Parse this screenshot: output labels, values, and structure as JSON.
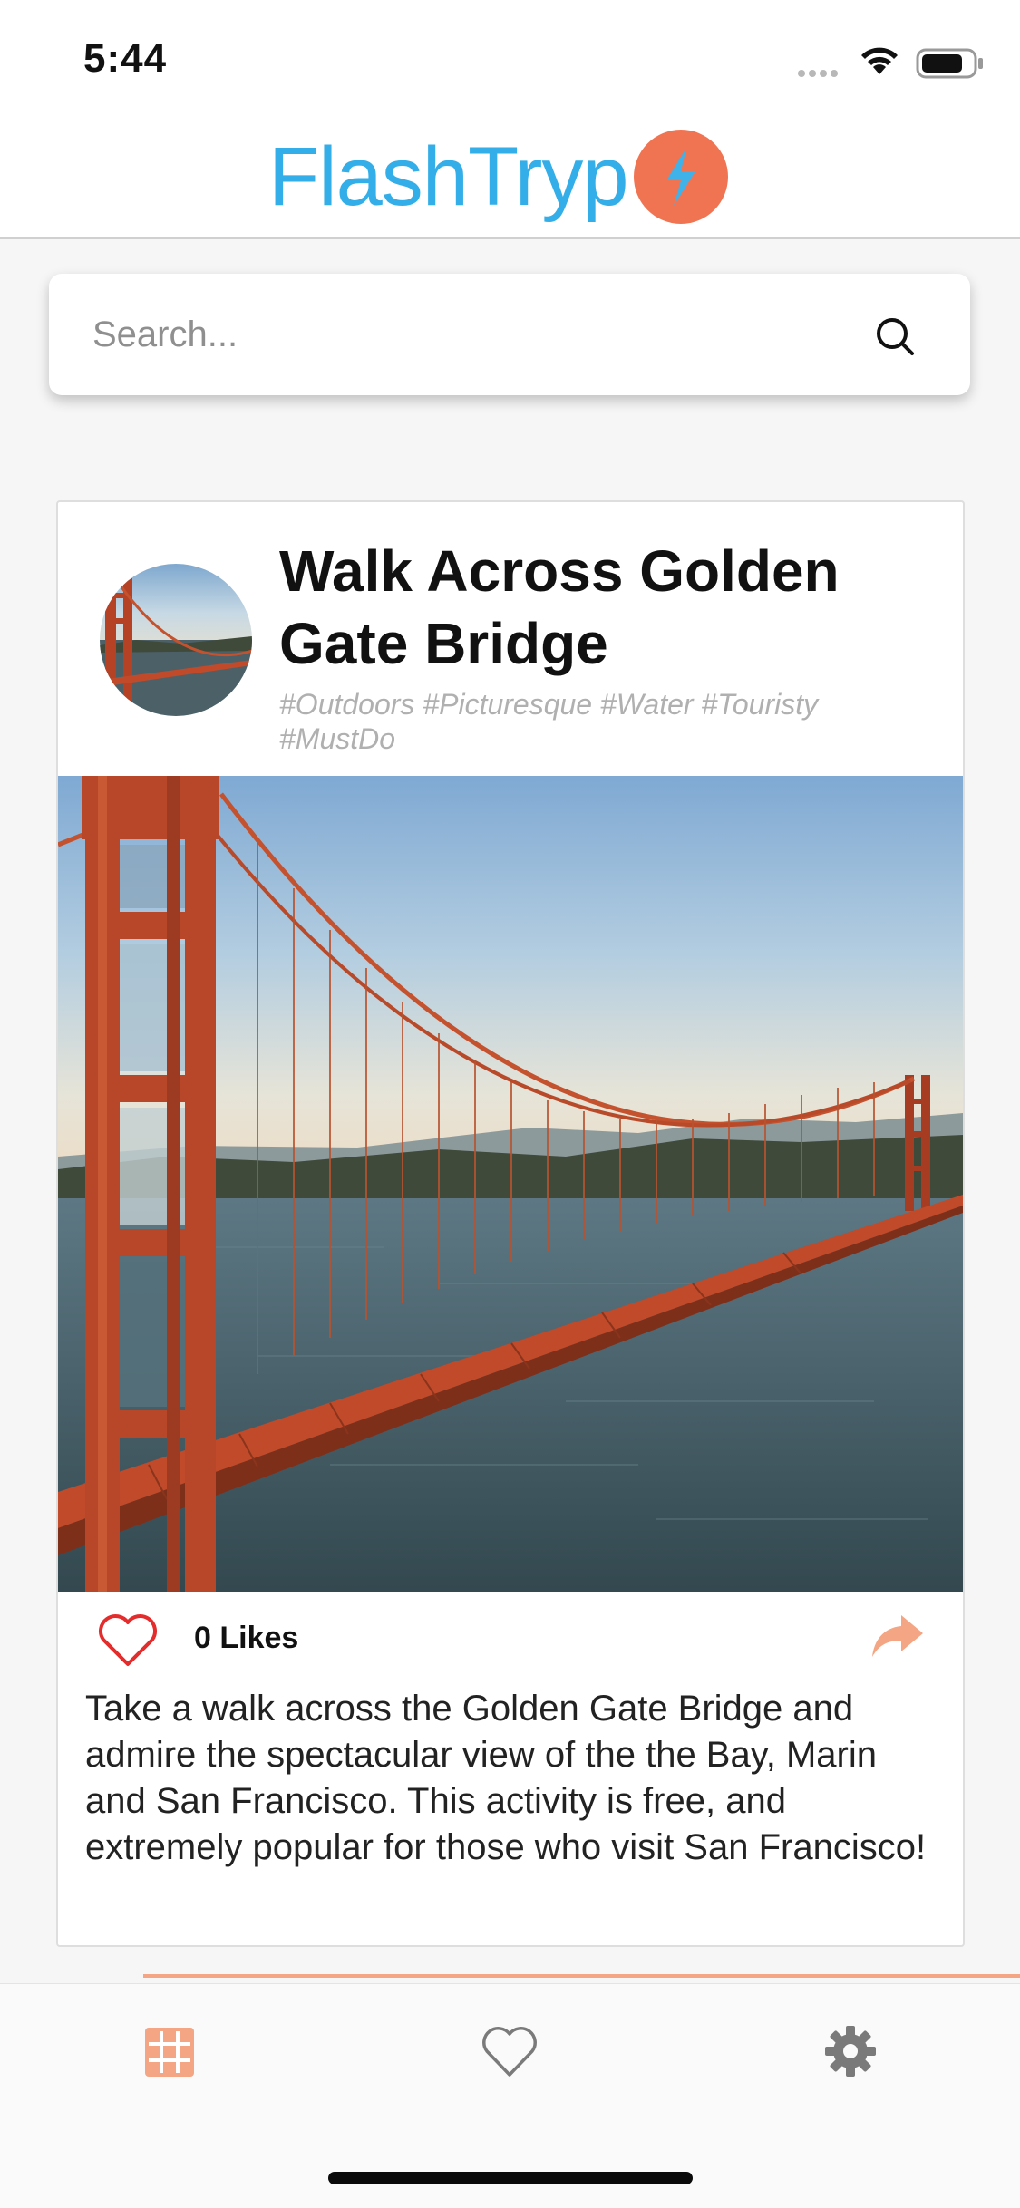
{
  "status_bar": {
    "time": "5:44"
  },
  "header": {
    "logo_text": "FlashTryp",
    "logo_color": "#33aee8",
    "logo_badge_color": "#f07452",
    "logo_badge_icon": "lightning-bolt-icon"
  },
  "search": {
    "placeholder": "Search...",
    "value": "",
    "icon": "search-icon"
  },
  "card": {
    "title": "Walk Across Golden Gate Bridge",
    "tags": "#Outdoors #Picturesque #Water #Touristy #MustDo",
    "likes_label": "0 Likes",
    "description": "Take a walk across the Golden Gate Bridge and admire the spectacular view of the the Bay, Marin and San Francisco. This activity is free, and extremely popular for those who visit San Francisco!",
    "like_icon": "heart-outline-icon",
    "share_icon": "share-arrow-icon",
    "accent_color": "#f4a583"
  },
  "tab_bar": {
    "tabs": [
      {
        "name": "feed",
        "icon": "grid-icon",
        "active": true
      },
      {
        "name": "favorites",
        "icon": "heart-icon",
        "active": false
      },
      {
        "name": "settings",
        "icon": "gear-icon",
        "active": false
      }
    ],
    "active_color": "#f4a583",
    "inactive_color": "#7a7a7a"
  }
}
